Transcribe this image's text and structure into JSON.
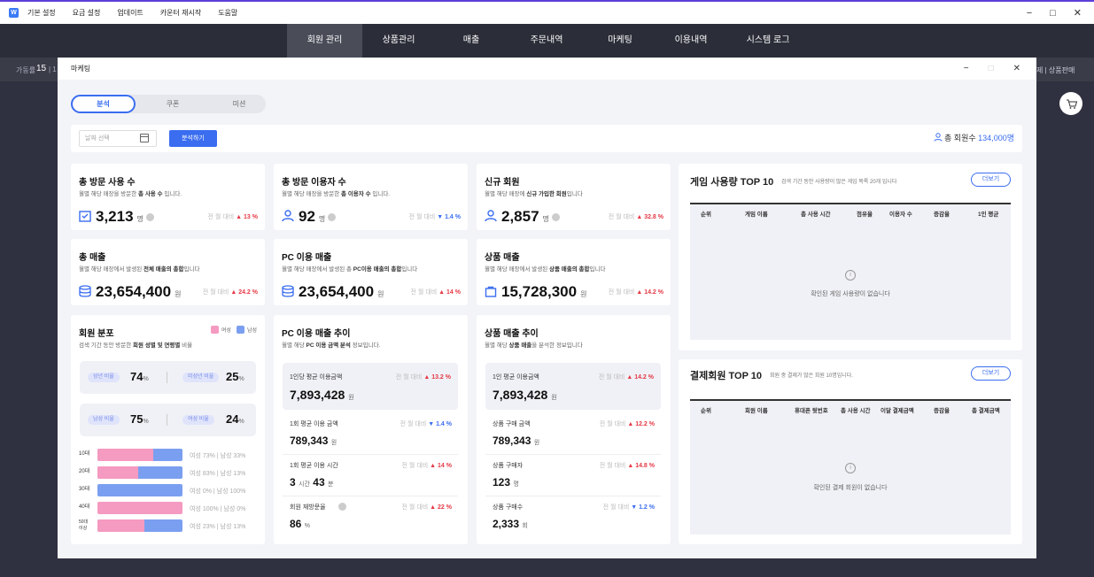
{
  "menu": {
    "items": [
      "기본 설정",
      "요금 설정",
      "업데이트",
      "카운터 재시작",
      "도움말"
    ]
  },
  "window_controls": [
    "−",
    "□",
    "✕"
  ],
  "nav": {
    "tabs": [
      "회원 관리",
      "상품관리",
      "매출",
      "주문내역",
      "마케팅",
      "이용내역",
      "시스템 로그"
    ],
    "active": "회원 관리"
  },
  "subbar": {
    "left_label": "가동률",
    "left_value": "15",
    "left_rest": "| 1",
    "right": "제 | 상품판매"
  },
  "dialog": {
    "title": "마케팅",
    "controls": [
      "−",
      "□",
      "✕"
    ],
    "segments": [
      "분석",
      "쿠폰",
      "미션"
    ],
    "filter": {
      "date_placeholder": "날짜 선택",
      "analyze_button": "분석하기",
      "members_label": "총 회원수",
      "members_count": "134,000명"
    }
  },
  "stats": [
    {
      "title": "총 방문 사용 수",
      "desc_pre": "월별 해당 매장을 방문한 ",
      "desc_bold": "총 사용 수",
      "desc_post": " 입니다.",
      "value": "3,213",
      "unit": "명",
      "compare": "전 월 대비",
      "dir": "up",
      "delta": "13 %"
    },
    {
      "title": "총 방문 이용자 수",
      "desc_pre": "월별 해당 매장을 방문한 ",
      "desc_bold": "총 이용자 수",
      "desc_post": " 입니다.",
      "value": "92",
      "unit": "명",
      "compare": "전 월 대비",
      "dir": "down",
      "delta": "1.4 %"
    },
    {
      "title": "신규 회원",
      "desc_pre": "월별 해당 매장에 ",
      "desc_bold": "신규 가입한 회원",
      "desc_post": "입니다",
      "value": "2,857",
      "unit": "명",
      "compare": "전 월 대비",
      "dir": "up",
      "delta": "32.8 %"
    },
    {
      "title": "총 매출",
      "desc_pre": "월별 해당 매장에서 발생된 ",
      "desc_bold": "전체 매출의 총합",
      "desc_post": "입니다",
      "value": "23,654,400",
      "unit": "원",
      "compare": "전 월 대비",
      "dir": "up",
      "delta": "24.2 %"
    },
    {
      "title": "PC 이용 매출",
      "desc_pre": "월별 해당 매장에서 발생된 총 ",
      "desc_bold": "PC이용 매출의 총합",
      "desc_post": "입니다",
      "value": "23,654,400",
      "unit": "원",
      "compare": "전 월 대비",
      "dir": "up",
      "delta": "14 %"
    },
    {
      "title": "상품 매출",
      "desc_pre": "월별 해당 매장에서 발생된 ",
      "desc_bold": "상품 매출의 총합",
      "desc_post": "입니다",
      "value": "15,728,300",
      "unit": "원",
      "compare": "전 월 대비",
      "dir": "up",
      "delta": "14.2 %"
    }
  ],
  "member_dist": {
    "title": "회원 분포",
    "legend": [
      "여성",
      "남성"
    ],
    "desc_pre": "검색 기간 동안 방문한 ",
    "desc_bold": "회원 성별 및 연령별",
    "desc_post": " 비율",
    "row1": [
      {
        "badge": "성년 비율",
        "value": "74",
        "unit": "%"
      },
      {
        "badge": "미성년 비율",
        "value": "25",
        "unit": "%"
      }
    ],
    "row2": [
      {
        "badge": "남성 비율",
        "value": "75",
        "unit": "%"
      },
      {
        "badge": "여성 비율",
        "value": "24",
        "unit": "%"
      }
    ],
    "ages": [
      {
        "label": "10대",
        "female_frac": 0.66,
        "text": "여성 73%  |  남성 33%"
      },
      {
        "label": "20대",
        "female_frac": 0.48,
        "text": "여성 83%  |  남성 13%"
      },
      {
        "label": "30대",
        "female_frac": 0.0,
        "text": "여성   0%  |  남성 100%"
      },
      {
        "label": "40대",
        "female_frac": 1.0,
        "text": "여성 100%  |  남성 0%"
      },
      {
        "label": "50대\n이상",
        "female_frac": 0.55,
        "text": "여성 23%  |  남성 13%"
      }
    ],
    "colors": {
      "female": "#f59ac0",
      "male": "#7b9ff0"
    }
  },
  "pc_trend": {
    "title": "PC 이용 매출 추이",
    "desc_pre": "월별 해당 ",
    "desc_bold": "PC 이용 금액 분석",
    "desc_post": " 정보입니다.",
    "highlight": {
      "label": "1인당 평균 이용금액",
      "value": "7,893,428",
      "unit": "원",
      "compare": "전 월 대비",
      "dir": "up",
      "delta": "13.2 %"
    },
    "rows": [
      {
        "label": "1회 평균 이용 금액",
        "value": "789,343",
        "unit": "원",
        "compare": "전 월 대비",
        "dir": "down",
        "delta": "1.4 %"
      },
      {
        "label": "1회 평균 이용 시간",
        "value": "3",
        "unit": "시간",
        "value2": "43",
        "unit2": "분",
        "compare": "전 월 대비",
        "dir": "up",
        "delta": "14 %"
      },
      {
        "label": "회원 재방문율",
        "value": "86",
        "unit": "%",
        "compare": "전 월 대비",
        "dir": "up",
        "delta": "22 %"
      }
    ]
  },
  "product_trend": {
    "title": "상품 매출 추이",
    "desc_pre": "월별 해당 ",
    "desc_bold": "상품 매출",
    "desc_post": "을 분석한 정보입니다",
    "highlight": {
      "label": "1인 평균 이용금액",
      "value": "7,893,428",
      "unit": "원",
      "compare": "전 월 대비",
      "dir": "up",
      "delta": "14.2 %"
    },
    "rows": [
      {
        "label": "상품 구매 금액",
        "value": "789,343",
        "unit": "원",
        "compare": "전 월 대비",
        "dir": "up",
        "delta": "12.2 %"
      },
      {
        "label": "상품 구매자",
        "value": "123",
        "unit": "명",
        "compare": "전 월 대비",
        "dir": "up",
        "delta": "14.8 %"
      },
      {
        "label": "상품 구매수",
        "value": "2,333",
        "unit": "회",
        "compare": "전 월 대비",
        "dir": "down",
        "delta": "1.2 %"
      }
    ]
  },
  "game_top": {
    "title": "게임 사용량 TOP 10",
    "subtitle": "검색 기간 동안 사용량이 많은 게임 목록 20개 입니다",
    "more": "더보기",
    "columns": [
      "순위",
      "게임 이름",
      "총 사용 시간",
      "점유율",
      "이용자 수",
      "증감율",
      "1인 평균"
    ],
    "empty": "확인된 게임 사용량이 없습니다"
  },
  "pay_top": {
    "title": "결제회원 TOP 10",
    "subtitle": "회원 중 결제가 많은 회원 10명입니다.",
    "more": "더보기",
    "columns": [
      "순위",
      "회원 이름",
      "휴대폰 뒷번호",
      "총 사용 시간",
      "이달 결제금액",
      "증감율",
      "총 결제금액"
    ],
    "empty": "확인된 결제 회원이 없습니다"
  }
}
